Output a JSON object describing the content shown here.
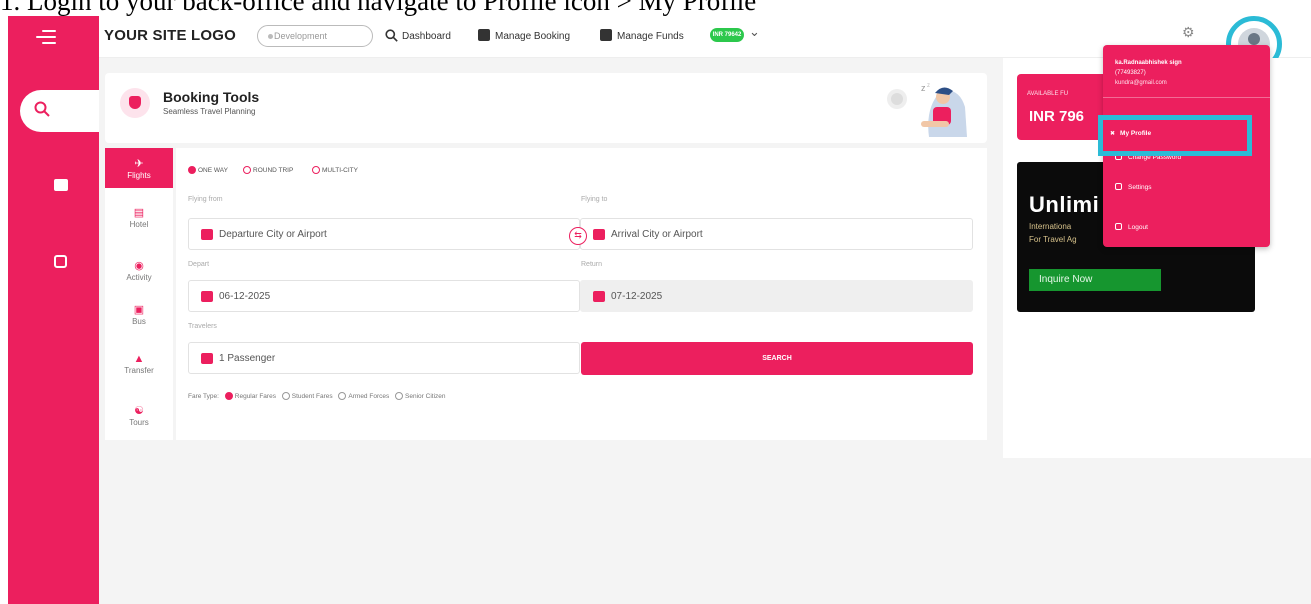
{
  "caption": "1. Login to your back-office and navigate to Profile icon > My Profile",
  "header": {
    "logo": "YOUR SITE LOGO",
    "env_badge": "Development",
    "nav": {
      "dashboard": "Dashboard",
      "manage_booking": "Manage Booking",
      "manage_funds": "Manage Funds",
      "funds_badge": "INR 79642"
    }
  },
  "booking_tools": {
    "title": "Booking Tools",
    "subtitle": "Seamless Travel Planning"
  },
  "side_tabs": [
    {
      "label": "Flights",
      "icon": "plane-icon",
      "active": true
    },
    {
      "label": "Hotel",
      "icon": "hotel-icon",
      "active": false
    },
    {
      "label": "Activity",
      "icon": "binoculars-icon",
      "active": false
    },
    {
      "label": "Bus",
      "icon": "bus-icon",
      "active": false
    },
    {
      "label": "Transfer",
      "icon": "car-icon",
      "active": false
    },
    {
      "label": "Tours",
      "icon": "palm-tree-icon",
      "active": false
    }
  ],
  "trip_types": {
    "one_way": "ONE WAY",
    "round_trip": "ROUND TRIP",
    "multi_city": "MULTI-CITY",
    "selected": "one_way"
  },
  "form": {
    "flying_from_label": "Flying from",
    "flying_from_placeholder": "Departure City or Airport",
    "flying_to_label": "Flying to",
    "flying_to_placeholder": "Arrival City or Airport",
    "depart_label": "Depart",
    "depart_value": "06-12-2025",
    "return_label": "Return",
    "return_value": "07-12-2025",
    "travelers_label": "Travelers",
    "travelers_value": "1 Passenger",
    "search_label": "SEARCH"
  },
  "fare_types": {
    "label": "Fare Type:",
    "regular": "Regular Fares",
    "student": "Student Fares",
    "armed": "Armed Forces",
    "senior": "Senior Citizen",
    "selected": "regular"
  },
  "funds_card": {
    "label": "AVAILABLE FU",
    "value": "INR 796"
  },
  "banner": {
    "title": "Unlimi",
    "line1": "Internationa",
    "line2": "For Travel Ag",
    "button": "Inquire Now"
  },
  "profile_menu": {
    "name": "ka.Radnaabhishek sign",
    "id": "(77493827)",
    "email": "kundra@gmail.com",
    "my_profile": "My Profile",
    "change_password": "Change Password",
    "settings": "Settings",
    "logout": "Logout"
  },
  "colors": {
    "brand": "#ec1f5e",
    "highlight": "#2bbbd6",
    "funds_badge": "#2cc84c",
    "banner_button": "#16962f"
  }
}
